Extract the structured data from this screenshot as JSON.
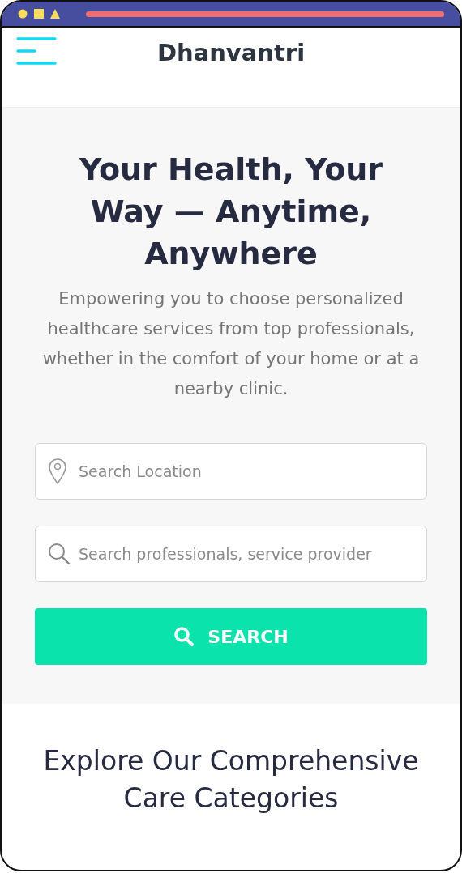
{
  "header": {
    "brand": "Dhanvantri"
  },
  "hero": {
    "title": "Your Health, Your Way — Anytime, Anywhere",
    "subtitle": "Empowering you to choose personalized healthcare services from top professionals, whether in the comfort of your home or at a nearby clinic.",
    "fields": [
      {
        "kind": "location",
        "placeholder": "Search Location"
      },
      {
        "kind": "search",
        "placeholder": "Search professionals, service provider"
      }
    ],
    "button": "SEARCH"
  },
  "categories": {
    "title": "Explore Our Comprehensive Care Categories"
  }
}
